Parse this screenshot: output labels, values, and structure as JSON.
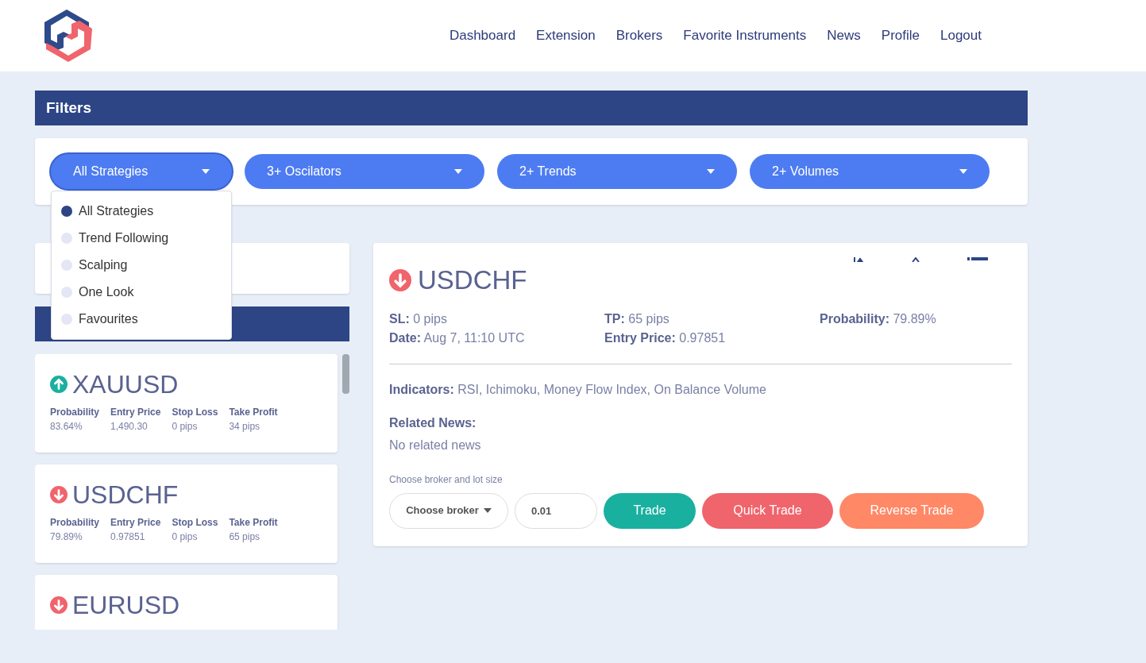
{
  "nav": [
    "Dashboard",
    "Extension",
    "Brokers",
    "Favorite Instruments",
    "News",
    "Profile",
    "Logout"
  ],
  "filters": {
    "title": "Filters",
    "dropdowns": [
      {
        "label": "All Strategies",
        "expanded": true,
        "options": [
          {
            "label": "All Strategies",
            "selected": true
          },
          {
            "label": "Trend Following",
            "selected": false
          },
          {
            "label": "Scalping",
            "selected": false
          },
          {
            "label": "One Look",
            "selected": false
          },
          {
            "label": "Favourites",
            "selected": false
          }
        ]
      },
      {
        "label": "3+ Oscilators",
        "expanded": false
      },
      {
        "label": "2+ Trends",
        "expanded": false
      },
      {
        "label": "2+ Volumes",
        "expanded": false
      }
    ]
  },
  "signals": [
    {
      "symbol": "XAUUSD",
      "kind": "up",
      "stats": [
        {
          "label": "Probability",
          "value": "83.64%"
        },
        {
          "label": "Entry Price",
          "value": "1,490.30"
        },
        {
          "label": "Stop Loss",
          "value": "0 pips"
        },
        {
          "label": "Take Profit",
          "value": "34 pips"
        }
      ]
    },
    {
      "symbol": "USDCHF",
      "kind": "down",
      "stats": [
        {
          "label": "Probability",
          "value": "79.89%"
        },
        {
          "label": "Entry Price",
          "value": "0.97851"
        },
        {
          "label": "Stop Loss",
          "value": "0 pips"
        },
        {
          "label": "Take Profit",
          "value": "65 pips"
        }
      ]
    },
    {
      "symbol": "EURUSD",
      "kind": "down"
    }
  ],
  "detail": {
    "symbol": "USDCHF",
    "kind": "down",
    "fields": [
      {
        "label": "SL:",
        "value": "0 pips"
      },
      {
        "label": "TP:",
        "value": "65 pips"
      },
      {
        "label": "Probability:",
        "value": "79.89%"
      },
      {
        "label": "Date:",
        "value": "Aug 7, 11:10 UTC"
      },
      {
        "label": "Entry Price:",
        "value": "0.97851"
      }
    ],
    "indicators": {
      "label": "Indicators:",
      "value": "RSI, Ichimoku, Money Flow Index, On Balance Volume"
    },
    "related_news": {
      "label": "Related News:",
      "value": "No related news"
    },
    "trade": {
      "caption": "Choose broker and lot size",
      "broker": "Choose broker",
      "lot": "0.01",
      "buttons": [
        {
          "label": "Trade",
          "kind": "trade"
        },
        {
          "label": "Quick Trade",
          "kind": "quick"
        },
        {
          "label": "Reverse Trade",
          "kind": "reverse"
        }
      ]
    }
  }
}
